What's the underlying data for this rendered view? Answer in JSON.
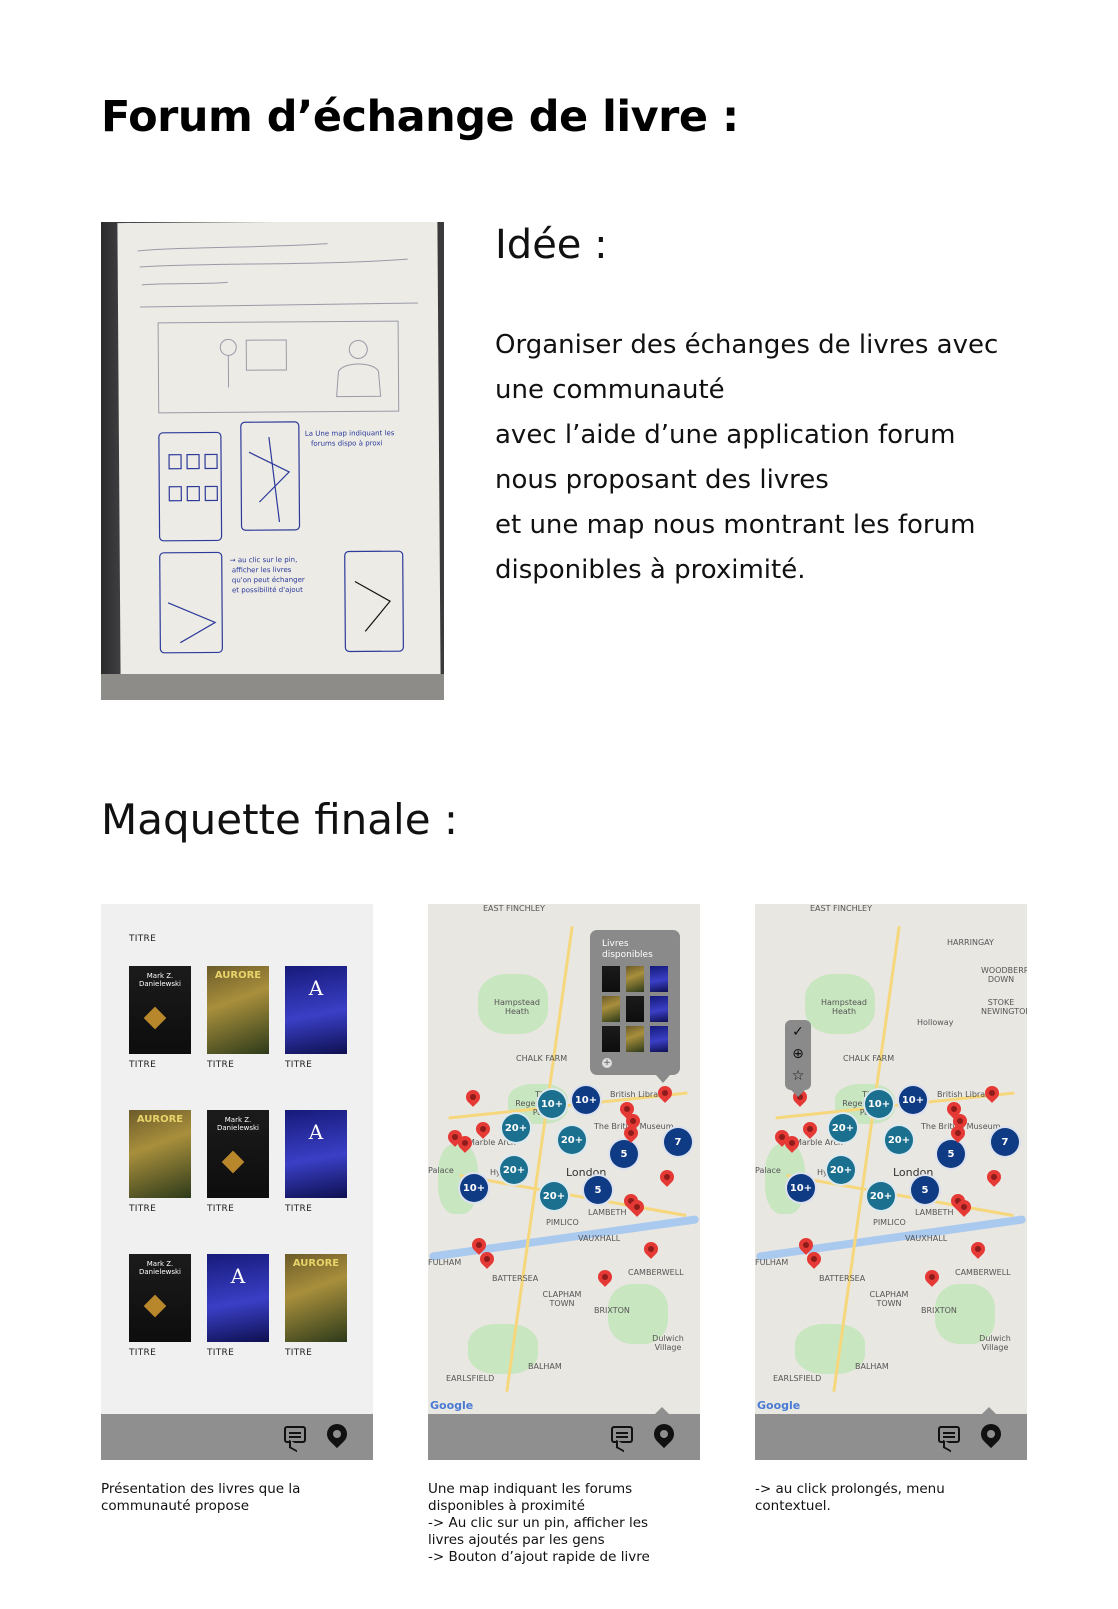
{
  "page": {
    "title": "Forum d’échange de livre :",
    "idea_title": "Idée :",
    "idea_lines": [
      "Organiser des échanges de livres avec",
      "une communauté",
      "avec l’aide d’une application forum",
      "nous proposant des livres",
      "et une map nous montrant les forum",
      "disponibles à proximité."
    ],
    "maquette_title": "Maquette finale :"
  },
  "mockup1": {
    "header": "TITRE",
    "book_label": "TITRE",
    "books": [
      {
        "style": "dark",
        "text": "Mark Z. Danielewski"
      },
      {
        "style": "gold",
        "text": "AURORE"
      },
      {
        "style": "blue",
        "text": "A"
      },
      {
        "style": "gold",
        "text": "AURORE"
      },
      {
        "style": "dark",
        "text": "Mark Z. Danielewski"
      },
      {
        "style": "blue",
        "text": "A"
      },
      {
        "style": "dark",
        "text": "Mark Z. Danielewski"
      },
      {
        "style": "blue",
        "text": "A"
      },
      {
        "style": "gold",
        "text": "AURORE"
      }
    ]
  },
  "map": {
    "labels": {
      "east_finchley": "EAST FINCHLEY",
      "hampstead": "Hampstead Heath",
      "chalk_farm": "CHALK FARM",
      "regents": "The Regent's Park",
      "british_library": "British Library",
      "british_museum": "The British Museum",
      "marble_arch": "Marble Arch",
      "palace": "Palace",
      "hyde": "Hy",
      "london": "London",
      "pimlico": "PIMLICO",
      "lambeth": "LAMBETH",
      "vauxhall": "VAUXHALL",
      "fulham": "FULHAM",
      "battersea": "BATTERSEA",
      "camberwell": "CAMBERWELL",
      "clapham": "CLAPHAM TOWN",
      "brixton": "BRIXTON",
      "dulwich": "Dulwich Village",
      "balham": "BALHAM",
      "earlsfield": "EARLSFIELD",
      "holloway": "Holloway",
      "harringay": "HARRINGAY",
      "woodberry": "WOODBERRY DOWN",
      "stoke": "STOKE NEWINGTON",
      "google": "Google"
    },
    "clusters": {
      "c1": "10+",
      "c2": "10+",
      "c3": "20+",
      "c4": "20+",
      "c5": "5",
      "c6": "7",
      "c7": "20+",
      "c8": "10+",
      "c9": "20+",
      "c10": "5"
    },
    "popup_label": "Livres disponibles"
  },
  "captions": {
    "c1": [
      "Présentation des livres que la",
      "communauté propose"
    ],
    "c2": [
      "Une map indiquant les forums",
      "disponibles à proximité",
      "-> Au clic sur un pin, afficher les",
      "livres ajoutés par les gens",
      "-> Bouton d’ajout rapide de livre"
    ],
    "c3": [
      "-> au click prolongés, menu",
      "contextuel."
    ]
  },
  "icons": {
    "message": "message-icon",
    "location": "map-pin-icon",
    "check": "check-icon",
    "add": "add-circle-icon",
    "star": "star-icon"
  }
}
